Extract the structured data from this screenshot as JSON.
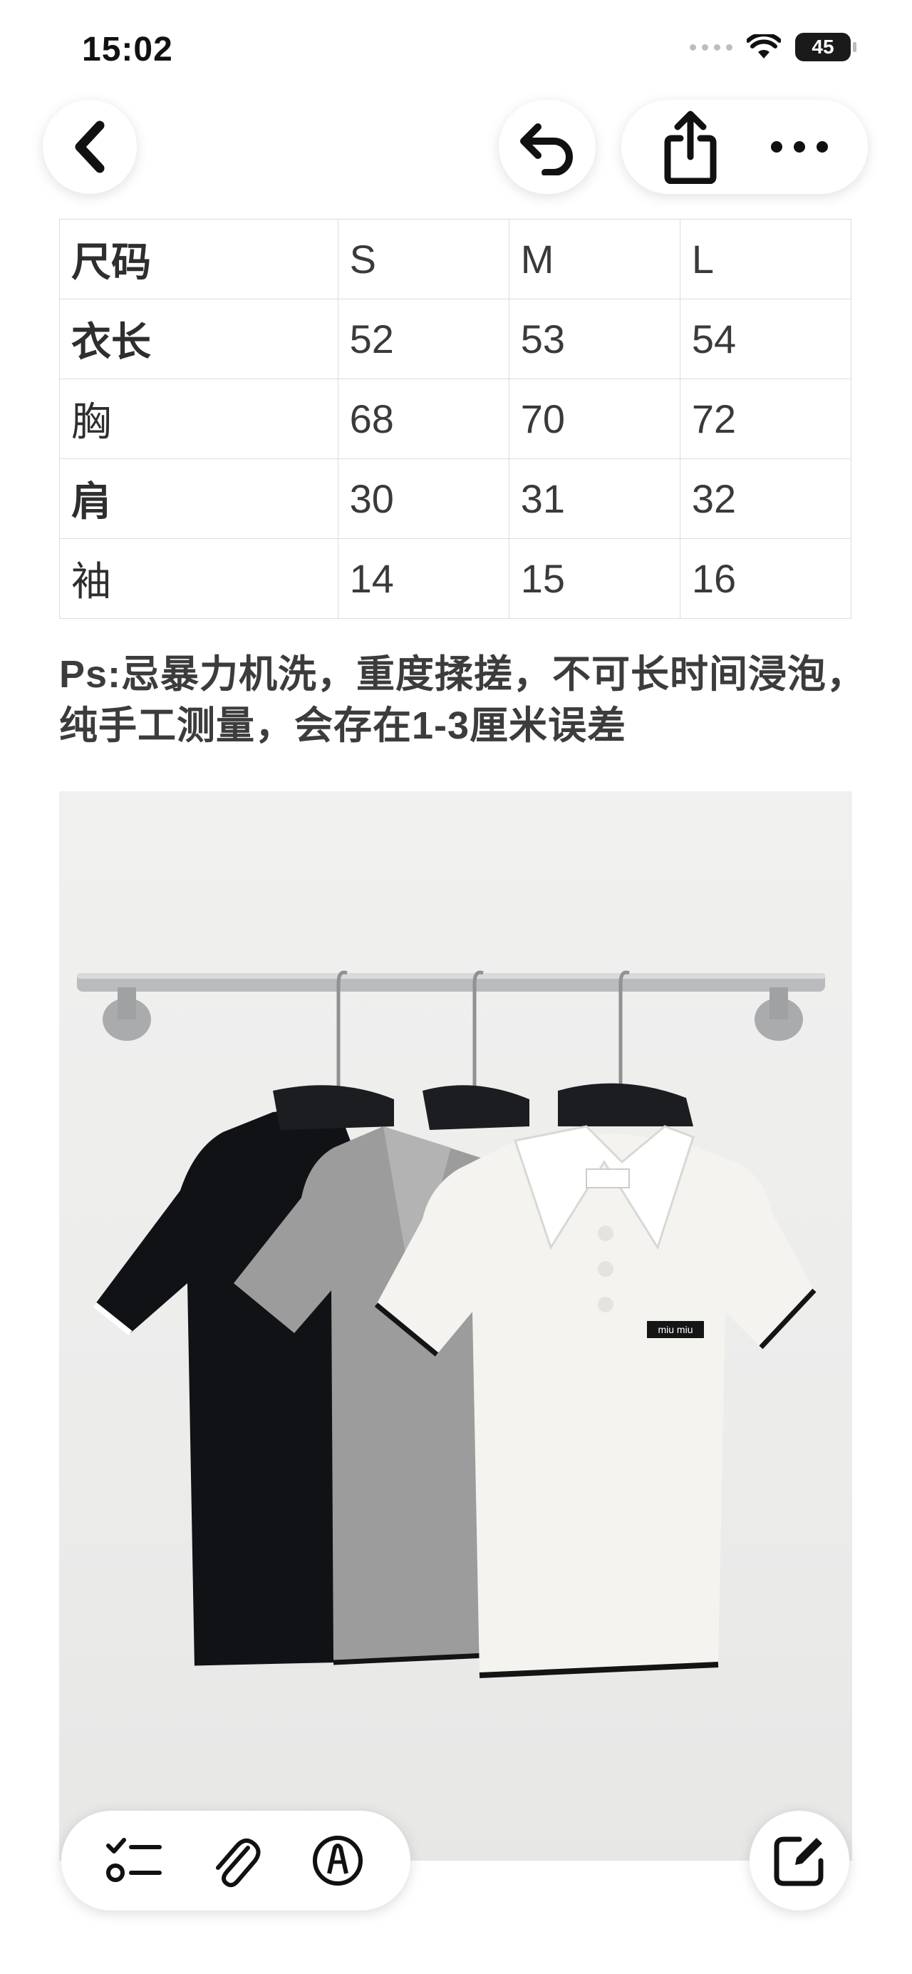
{
  "status_bar": {
    "time": "15:02",
    "battery": "45"
  },
  "icons": {
    "back": "chevron-left-icon",
    "undo": "undo-icon",
    "share": "share-icon",
    "more": "more-icon",
    "checklist": "checklist-icon",
    "attach": "paperclip-icon",
    "markup": "markup-pen-icon",
    "compose": "compose-icon"
  },
  "size_table": {
    "header": [
      "尺码",
      "S",
      "M",
      "L"
    ],
    "rows": [
      [
        "衣长",
        "52",
        "53",
        "54"
      ],
      [
        "胸",
        "68",
        "70",
        "72"
      ],
      [
        "肩",
        "30",
        "31",
        "32"
      ],
      [
        "袖",
        "14",
        "15",
        "16"
      ]
    ]
  },
  "note": "Ps:忌暴力机洗，重度揉搓，不可长时间浸泡，纯手工测量，会存在1-3厘米误差",
  "photo": {
    "label_text": "miu miu",
    "colors": {
      "black_shirt": "#111216",
      "grey_shirt": "#9c9c9c",
      "white_shirt": "#f4f3ef",
      "rail": "#b9bbbd"
    }
  }
}
